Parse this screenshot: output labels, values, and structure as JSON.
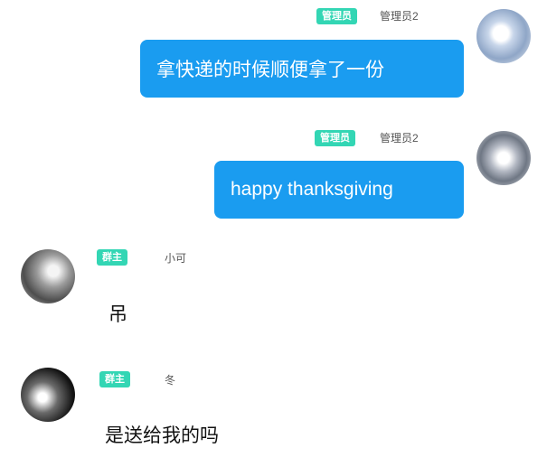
{
  "messages": [
    {
      "side": "right",
      "badge": "管理员",
      "name": "管理员2",
      "text": "拿快递的时候顺便拿了一份"
    },
    {
      "side": "right",
      "badge": "管理员",
      "name": "管理员2",
      "text": "happy thanksgiving"
    },
    {
      "side": "left",
      "badge": "群主",
      "name": "小可",
      "text": "吊"
    },
    {
      "side": "left",
      "badge": "群主",
      "name": "冬",
      "text": "是送给我的吗"
    }
  ],
  "colors": {
    "bubble": "#1a9cf0",
    "badge": "#33d6b4"
  }
}
